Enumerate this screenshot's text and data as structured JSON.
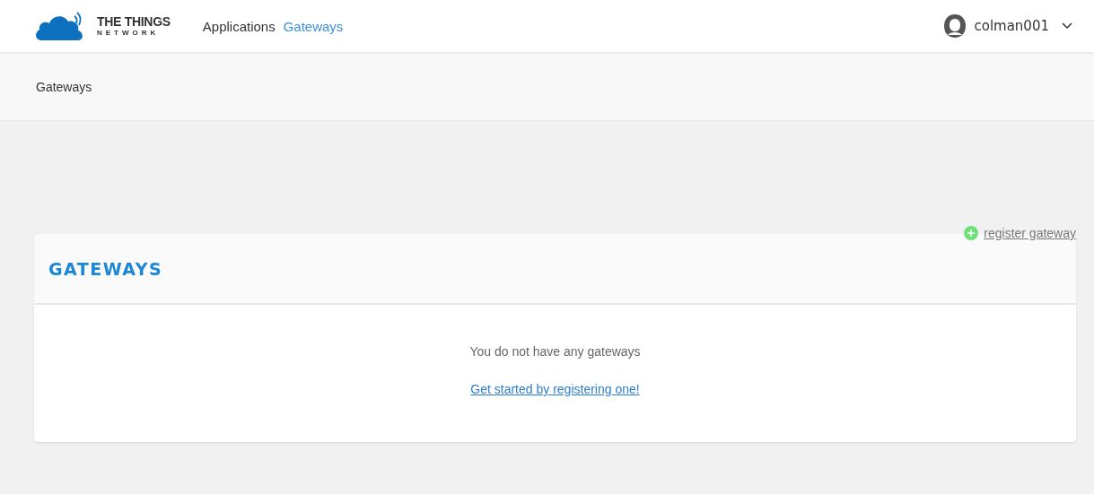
{
  "logo": {
    "title": "THE THINGS",
    "subtitle": "NETWORK"
  },
  "nav": [
    {
      "label": "Applications",
      "selected": false
    },
    {
      "label": "Gateways",
      "selected": true
    }
  ],
  "user": {
    "name": "colman001"
  },
  "breadcrumb": "Gateways",
  "register_link": "register gateway",
  "card": {
    "title": "GATEWAYS",
    "empty_message": "You do not have any gateways",
    "cta_link": "Get started by registering one!"
  }
}
